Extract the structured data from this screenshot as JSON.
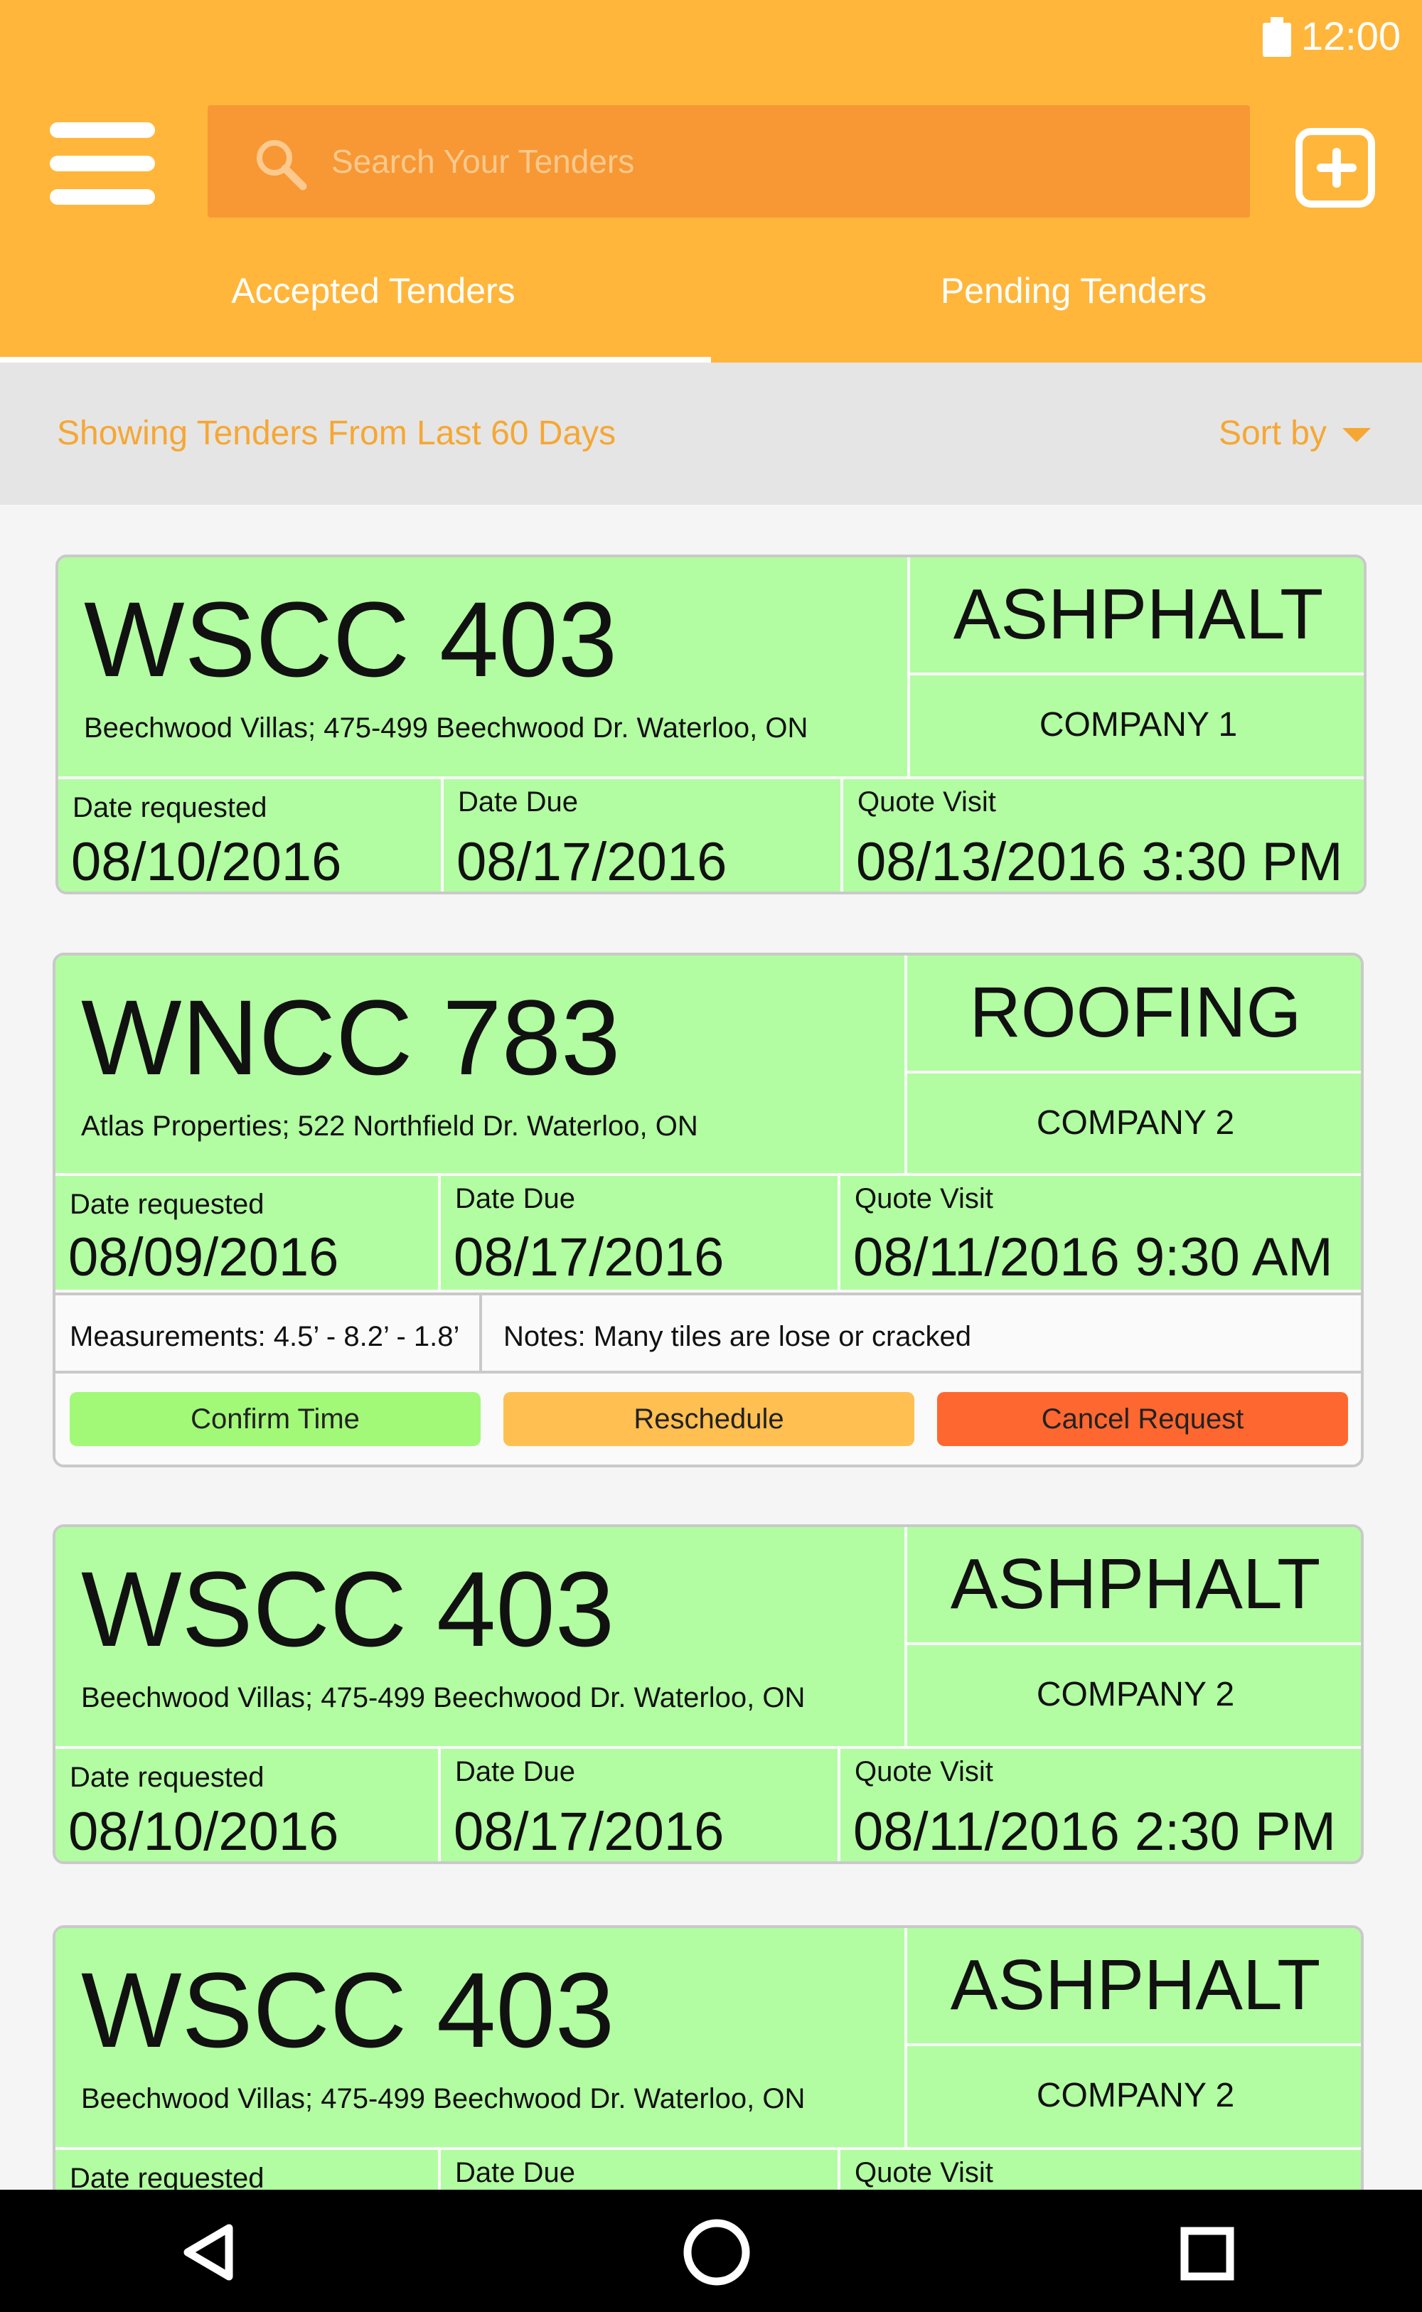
{
  "status_bar": {
    "time": "12:00",
    "battery_icon": "battery-icon"
  },
  "header": {
    "menu_icon": "hamburger-menu-icon",
    "search_placeholder": "Search Your Tenders",
    "add_icon": "add-square-icon",
    "tabs": [
      {
        "label": "Accepted Tenders",
        "active": true
      },
      {
        "label": "Pending Tenders",
        "active": false
      }
    ]
  },
  "filter_bar": {
    "label": "Showing Tenders From Last 60 Days",
    "sort_label": "Sort by"
  },
  "colors": {
    "app_bar": "#ffb63b",
    "search_field": "#f79834",
    "card_green": "#b2fda1",
    "accent_text": "#f6a733",
    "confirm": "#a2f978",
    "reschedule": "#ffbf51",
    "cancel": "#ff6730"
  },
  "cards": [
    {
      "code": "WSCC 403",
      "address": "Beechwood Villas; 475-499 Beechwood Dr. Waterloo, ON",
      "category": "ASHPHALT",
      "company": "COMPANY 1",
      "date_requested_label": "Date requested",
      "date_requested": "08/10/2016",
      "date_due_label": "Date Due",
      "date_due": "08/17/2016",
      "quote_visit_label": "Quote Visit",
      "quote_visit": "08/13/2016 3:30 PM"
    },
    {
      "code": "WNCC 783",
      "address": "Atlas Properties; 522 Northfield Dr. Waterloo, ON",
      "category": "ROOFING",
      "company": "COMPANY 2",
      "date_requested_label": "Date requested",
      "date_requested": "08/09/2016",
      "date_due_label": "Date Due",
      "date_due": "08/17/2016",
      "quote_visit_label": "Quote Visit",
      "quote_visit": "08/11/2016 9:30 AM",
      "measurements": "Measurements: 4.5’ - 8.2’ - 1.8’",
      "notes": "Notes: Many tiles are lose or cracked",
      "actions": {
        "confirm": "Confirm Time",
        "reschedule": "Reschedule",
        "cancel": "Cancel Request"
      }
    },
    {
      "code": "WSCC 403",
      "address": "Beechwood Villas; 475-499 Beechwood Dr. Waterloo, ON",
      "category": "ASHPHALT",
      "company": "COMPANY 2",
      "date_requested_label": "Date requested",
      "date_requested": "08/10/2016",
      "date_due_label": "Date Due",
      "date_due": "08/17/2016",
      "quote_visit_label": "Quote Visit",
      "quote_visit": "08/11/2016 2:30 PM"
    },
    {
      "code": "WSCC 403",
      "address": "Beechwood Villas; 475-499 Beechwood Dr. Waterloo, ON",
      "category": "ASHPHALT",
      "company": "COMPANY 2",
      "date_requested_label": "Date requested",
      "date_due_label": "Date Due",
      "quote_visit_label": "Quote Visit"
    }
  ],
  "nav_bar": {
    "back_icon": "back-triangle-icon",
    "home_icon": "home-circle-icon",
    "recents_icon": "recents-square-icon"
  }
}
